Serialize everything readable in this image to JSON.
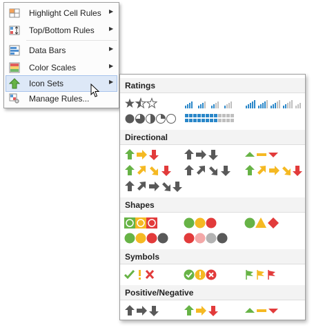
{
  "menu": {
    "items": [
      {
        "label": "Highlight Cell Rules",
        "icon": "highlight-cell-rules-icon",
        "has_submenu": true
      },
      {
        "label": "Top/Bottom Rules",
        "icon": "top-bottom-rules-icon",
        "has_submenu": true
      },
      {
        "label": "Data Bars",
        "icon": "data-bars-icon",
        "has_submenu": true
      },
      {
        "label": "Color Scales",
        "icon": "color-scales-icon",
        "has_submenu": true
      },
      {
        "label": "Icon Sets",
        "icon": "icon-sets-icon",
        "has_submenu": true,
        "highlighted": true
      },
      {
        "label": "Manage Rules...",
        "icon": "manage-rules-icon",
        "has_submenu": false
      }
    ],
    "submenu_arrow": "▶"
  },
  "gallery": {
    "sections": [
      {
        "title": "Ratings",
        "items": [
          "stars-3",
          "signal-bars-4",
          "signal-bars-5",
          "quarters-5",
          "boxes-5"
        ]
      },
      {
        "title": "Directional",
        "items": [
          "arrows-3-colored",
          "arrows-3-gray",
          "triangles-3",
          "arrows-4-colored",
          "arrows-4-gray",
          "arrows-5-colored",
          "arrows-5-gray"
        ]
      },
      {
        "title": "Shapes",
        "items": [
          "traffic-lights-3-rimmed",
          "traffic-lights-3-unrimmed",
          "signs-3",
          "traffic-lights-4",
          "red-to-black-4"
        ]
      },
      {
        "title": "Symbols",
        "items": [
          "symbols-3-uncircled",
          "symbols-3-circled",
          "flags-3"
        ]
      },
      {
        "title": "Positive/Negative",
        "items": [
          "arrows-3-gray-pn",
          "arrows-3-colored-pn",
          "triangles-3-pn"
        ]
      }
    ]
  },
  "colors": {
    "green": "#67b346",
    "yellow": "#f5b923",
    "red": "#e23b3b",
    "gray": "#595959",
    "blue": "#2a87c9",
    "light_gray": "#bfbfbf",
    "menu_highlight": "#dde8f7"
  }
}
